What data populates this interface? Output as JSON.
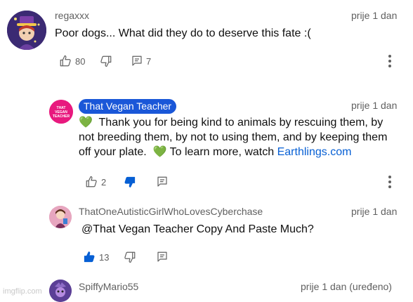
{
  "comments": [
    {
      "author": "regaxxx",
      "time": "prije 1 dan",
      "text": "Poor dogs... What did they do to deserve this fate :(",
      "likes": "80",
      "replies": "7"
    },
    {
      "author": "That Vegan Teacher",
      "time": "prije 1 dan",
      "avatar_text": "THAT VEGAN TEACHER",
      "text_line1": "Thank you for being kind to animals by rescuing them, by",
      "text_line2": "not breeding them, by not to using them, and by keeping them",
      "text_line3a": "off your plate.",
      "text_line3b": "To learn more, watch",
      "link": "Earthlings.com",
      "emoji": "💚",
      "likes": "2"
    },
    {
      "author": "ThatOneAutisticGirlWhoLovesCyberchase",
      "time": "prije 1 dan",
      "text": "@That Vegan Teacher  Copy And Paste Much?",
      "likes": "13"
    },
    {
      "author": "SpiffyMario55",
      "time": "prije 1 dan (uređeno)"
    }
  ],
  "watermark": "imgflip.com",
  "colors": {
    "badge": "#1a57d8",
    "link": "#065fd4",
    "liked": "#065fd4",
    "green_heart": "#6ab04c"
  },
  "icons": [
    "thumbs-up-icon",
    "thumbs-down-icon",
    "reply-icon",
    "more-vert-icon"
  ]
}
